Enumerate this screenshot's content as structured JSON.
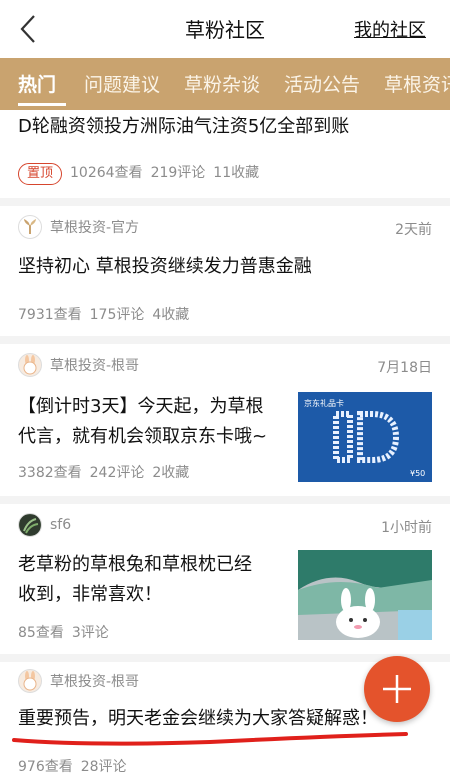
{
  "header": {
    "title": "草粉社区",
    "my_community": "我的社区"
  },
  "tabs": [
    "热门",
    "问题建议",
    "草粉杂谈",
    "活动公告",
    "草根资讯"
  ],
  "colors": {
    "tab_bar": "#c9a36f",
    "accent_red": "#d6452d",
    "fab": "#e4532c"
  },
  "posts": [
    {
      "title": "D轮融资领投方洲际油气注资5亿全部到账",
      "pinned_label": "置顶",
      "views": "10264查看",
      "comments": "219评论",
      "favorites": "11收藏"
    },
    {
      "author": "草根投资-官方",
      "time": "2天前",
      "title": "坚持初心 草根投资继续发力普惠金融",
      "views": "7931查看",
      "comments": "175评论",
      "favorites": "4收藏"
    },
    {
      "author": "草根投资-根哥",
      "time": "7月18日",
      "title_line1": "【倒计时3天】今天起，为草根",
      "title_line2": "代言，就有机会领取京东卡哦~",
      "views": "3382查看",
      "comments": "242评论",
      "favorites": "2收藏",
      "thumb_label": "京东礼品卡",
      "thumb_value": "¥50"
    },
    {
      "author": "sf6",
      "time": "1小时前",
      "title_line1": "老草粉的草根兔和草根枕已经",
      "title_line2": "收到，非常喜欢！",
      "views": "85查看",
      "comments": "3评论"
    },
    {
      "author": "草根投资-根哥",
      "title": "重要预告，明天老金会继续为大家答疑解惑！",
      "views": "976查看",
      "comments": "28评论"
    }
  ]
}
